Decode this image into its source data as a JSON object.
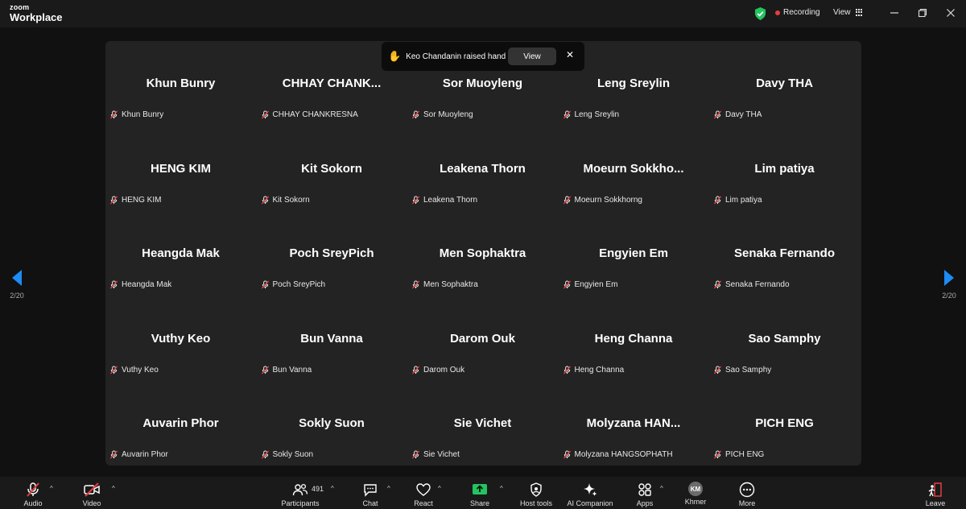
{
  "app": {
    "brand_top": "zoom",
    "brand_bottom": "Workplace"
  },
  "titlebar": {
    "recording_label": "Recording",
    "view_label": "View"
  },
  "notification": {
    "icon": "raised-hand-icon",
    "message": "Keo Chandanin raised hand",
    "view_button": "View",
    "close": "✕"
  },
  "pagination": {
    "left": "2/20",
    "right": "2/20"
  },
  "participants": [
    {
      "display": "Khun Bunry",
      "name": "Khun Bunry"
    },
    {
      "display": "CHHAY  CHANK...",
      "name": "CHHAY CHANKRESNA"
    },
    {
      "display": "Sor Muoyleng",
      "name": "Sor Muoyleng"
    },
    {
      "display": "Leng Sreylin",
      "name": "Leng Sreylin"
    },
    {
      "display": "Davy THA",
      "name": "Davy THA"
    },
    {
      "display": "HENG KIM",
      "name": "HENG KIM"
    },
    {
      "display": "Kit Sokorn",
      "name": "Kit Sokorn"
    },
    {
      "display": "Leakena Thorn",
      "name": "Leakena Thorn"
    },
    {
      "display": "Moeurn  Sokkho...",
      "name": "Moeurn Sokkhorng"
    },
    {
      "display": "Lim patiya",
      "name": "Lim patiya"
    },
    {
      "display": "Heangda Mak",
      "name": "Heangda Mak"
    },
    {
      "display": "Poch SreyPich",
      "name": "Poch SreyPich"
    },
    {
      "display": "Men Sophaktra",
      "name": "Men Sophaktra"
    },
    {
      "display": "Engyien Em",
      "name": "Engyien Em"
    },
    {
      "display": "Senaka Fernando",
      "name": "Senaka Fernando"
    },
    {
      "display": "Vuthy Keo",
      "name": "Vuthy Keo"
    },
    {
      "display": "Bun Vanna",
      "name": "Bun Vanna"
    },
    {
      "display": "Darom Ouk",
      "name": "Darom Ouk"
    },
    {
      "display": "Heng Channa",
      "name": "Heng Channa"
    },
    {
      "display": "Sao Samphy",
      "name": "Sao Samphy"
    },
    {
      "display": "Auvarin Phor",
      "name": "Auvarin Phor"
    },
    {
      "display": "Sokly Suon",
      "name": "Sokly Suon"
    },
    {
      "display": "Sie Vichet",
      "name": "Sie Vichet"
    },
    {
      "display": "Molyzana  HAN...",
      "name": "Molyzana HANGSOPHATH"
    },
    {
      "display": "PICH ENG",
      "name": "PICH ENG"
    }
  ],
  "toolbar": {
    "audio": "Audio",
    "video": "Video",
    "participants": "Participants",
    "participants_count": "491",
    "chat": "Chat",
    "react": "React",
    "share": "Share",
    "host_tools": "Host tools",
    "ai_companion": "AI Companion",
    "apps": "Apps",
    "language": "Khmer",
    "language_avatar": "KM",
    "more": "More",
    "leave": "Leave"
  },
  "colors": {
    "accent": "#0e72ed",
    "share_green": "#22c55e",
    "mute_red": "#e53e3e",
    "recording": "#e53e3e",
    "shield_green": "#22c55e"
  }
}
